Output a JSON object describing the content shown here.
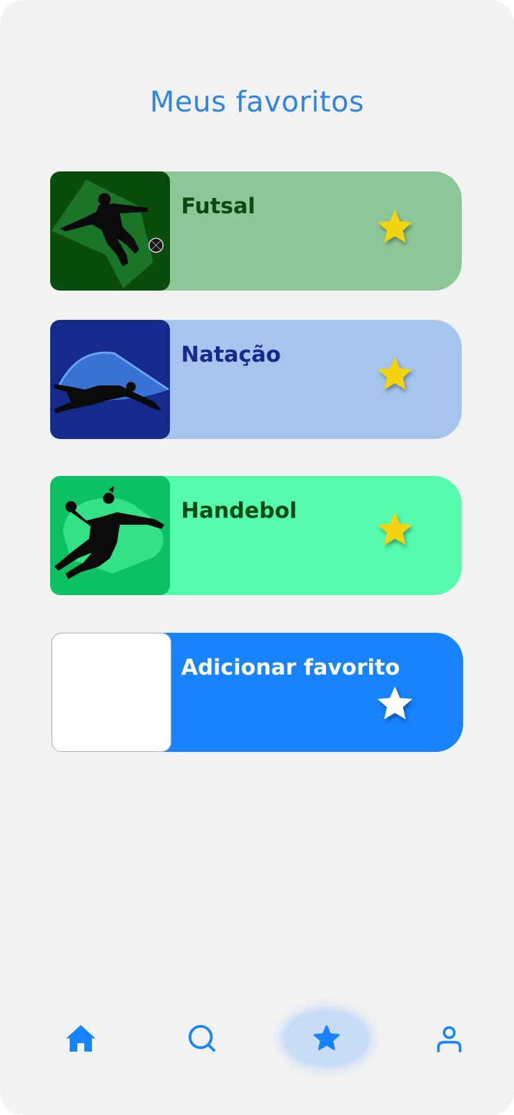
{
  "page": {
    "title": "Meus favoritos"
  },
  "favorites": [
    {
      "label": "Futsal",
      "sport_icon": "futsal-player-icon",
      "starred": true
    },
    {
      "label": "Natação",
      "sport_icon": "swimmer-icon",
      "starred": true
    },
    {
      "label": "Handebol",
      "sport_icon": "handball-player-icon",
      "starred": true
    }
  ],
  "add_favorite": {
    "label": "Adicionar favorito"
  },
  "bottom_nav": {
    "items": [
      {
        "icon": "home-icon",
        "active": false
      },
      {
        "icon": "search-icon",
        "active": false
      },
      {
        "icon": "star-icon",
        "active": true
      },
      {
        "icon": "user-icon",
        "active": false
      }
    ]
  },
  "colors": {
    "background": "#f2f2f3",
    "title": "#2f86e0",
    "accent_blue": "#1883ff",
    "star_gold": "#f2d410",
    "futsal_card": "#8ec797",
    "futsal_thumb": "#0a4b0e",
    "futsal_text": "#0c4a12",
    "natacao_card": "#a5c5ee",
    "natacao_thumb": "#142b8c",
    "natacao_text": "#17298a",
    "handebol_card": "#55fcae",
    "handebol_thumb": "#0cc163",
    "handebol_text": "#0a4a14"
  }
}
